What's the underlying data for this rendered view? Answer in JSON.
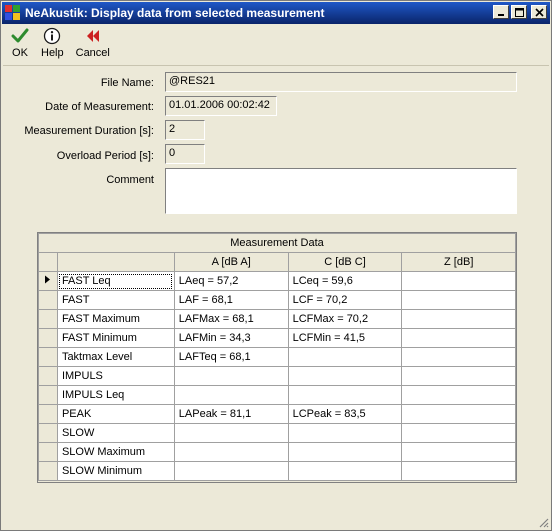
{
  "window": {
    "title": "NeAkustik: Display data from selected measurement",
    "controls": [
      "minimize",
      "maximize",
      "close"
    ]
  },
  "toolbar": {
    "items": [
      {
        "label": "OK",
        "icon": "checkmark-icon",
        "color": "#2e8b2e"
      },
      {
        "label": "Help",
        "icon": "info-icon",
        "color": "#1a1a1a"
      },
      {
        "label": "Cancel",
        "icon": "double-left-arrow-icon",
        "color": "#cc2020"
      }
    ]
  },
  "form": {
    "file_name_label": "File Name:",
    "file_name_value": "@RES21",
    "date_label": "Date of Measurement:",
    "date_value": "01.01.2006 00:02:42",
    "duration_label": "Measurement Duration [s]:",
    "duration_value": "2",
    "overload_label": "Overload Period [s]:",
    "overload_value": "0",
    "comment_label": "Comment",
    "comment_value": ""
  },
  "grid": {
    "caption": "Measurement Data",
    "columns": [
      "",
      "A [dB A]",
      "C [dB C]",
      "Z [dB]"
    ],
    "rows": [
      {
        "name": "FAST Leq",
        "a": "LAeq = 57,2",
        "c": "LCeq = 59,6",
        "z": ""
      },
      {
        "name": "FAST",
        "a": "LAF = 68,1",
        "c": "LCF = 70,2",
        "z": ""
      },
      {
        "name": "FAST Maximum",
        "a": "LAFMax = 68,1",
        "c": "LCFMax = 70,2",
        "z": ""
      },
      {
        "name": "FAST Minimum",
        "a": "LAFMin = 34,3",
        "c": "LCFMin = 41,5",
        "z": ""
      },
      {
        "name": "Taktmax Level",
        "a": "LAFTeq = 68,1",
        "c": "",
        "z": ""
      },
      {
        "name": "IMPULS",
        "a": "",
        "c": "",
        "z": ""
      },
      {
        "name": "IMPULS Leq",
        "a": "",
        "c": "",
        "z": ""
      },
      {
        "name": "PEAK",
        "a": "LAPeak = 81,1",
        "c": "LCPeak = 83,5",
        "z": ""
      },
      {
        "name": "SLOW",
        "a": "",
        "c": "",
        "z": ""
      },
      {
        "name": "SLOW Maximum",
        "a": "",
        "c": "",
        "z": ""
      },
      {
        "name": "SLOW Minimum",
        "a": "",
        "c": "",
        "z": ""
      }
    ],
    "selected_row": 0
  }
}
